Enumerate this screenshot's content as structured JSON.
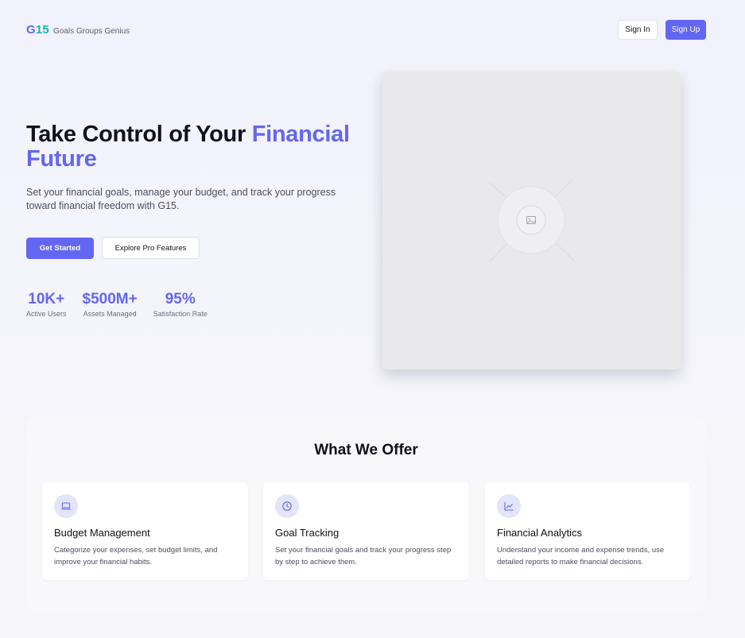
{
  "brand": {
    "mark_g": "G",
    "mark_n": "15",
    "tagline": "Goals Groups Genius",
    "color_primary": "#6366f1",
    "color_secondary": "#14b8a6"
  },
  "header": {
    "signin_label": "Sign In",
    "signup_label": "Sign Up"
  },
  "hero": {
    "title_part1": "Take Control of Your ",
    "title_accent": "Financial Future",
    "subtitle": "Set your financial goals, manage your budget, and track your progress toward financial freedom with G15.",
    "primary_cta": "Get Started",
    "secondary_cta": "Explore Pro Features",
    "image_icon": "image-placeholder-icon"
  },
  "stats": [
    {
      "value": "10K+",
      "label": "Active Users"
    },
    {
      "value": "$500M+",
      "label": "Assets Managed"
    },
    {
      "value": "95%",
      "label": "Satisfaction Rate"
    }
  ],
  "offer": {
    "title": "What We Offer",
    "cards": [
      {
        "icon": "laptop-icon",
        "title": "Budget Management",
        "description": "Categorize your expenses, set budget limits, and improve your financial habits."
      },
      {
        "icon": "clock-icon",
        "title": "Goal Tracking",
        "description": "Set your financial goals and track your progress step by step to achieve them."
      },
      {
        "icon": "chart-line-icon",
        "title": "Financial Analytics",
        "description": "Understand your income and expense trends, use detailed reports to make financial decisions."
      }
    ]
  }
}
